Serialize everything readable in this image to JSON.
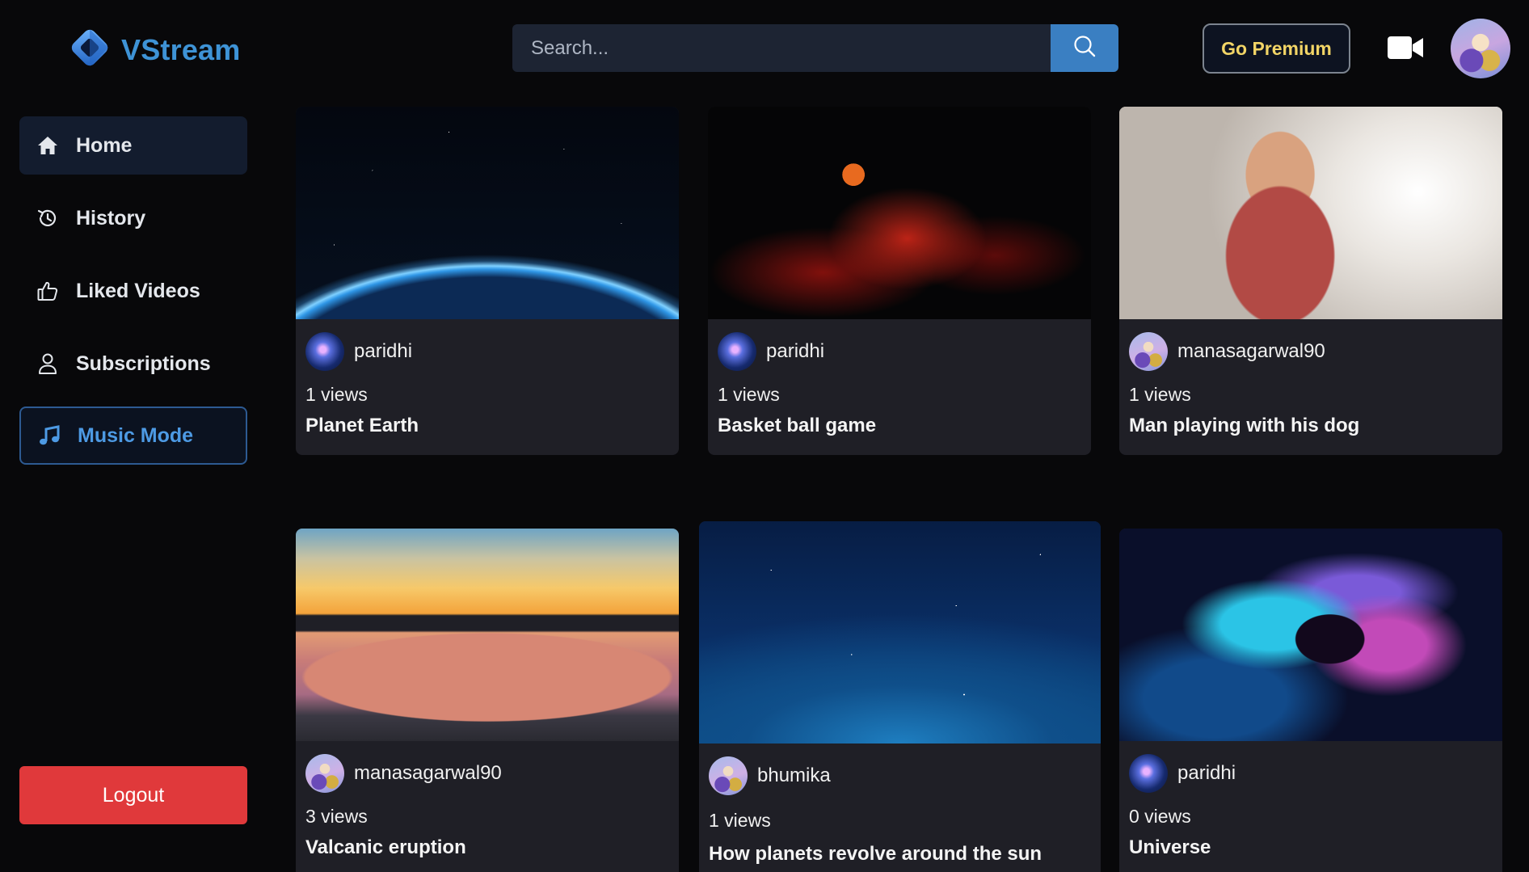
{
  "app": {
    "name": "VStream",
    "brand_color": "#3e93d6",
    "logo_icon": "diamond-logo-icon"
  },
  "header": {
    "search_placeholder": "Search...",
    "search_icon": "search-icon",
    "premium_label": "Go Premium",
    "upload_icon": "video-camera-icon",
    "avatar_icon": "user-avatar"
  },
  "sidebar": {
    "items": [
      {
        "label": "Home",
        "icon": "home-icon",
        "active": true
      },
      {
        "label": "History",
        "icon": "history-icon"
      },
      {
        "label": "Liked Videos",
        "icon": "thumbs-up-icon"
      },
      {
        "label": "Subscriptions",
        "icon": "user-icon"
      },
      {
        "label": "Music Mode",
        "icon": "music-note-icon"
      }
    ],
    "logout_label": "Logout"
  },
  "videos": [
    {
      "channel": "paridhi",
      "views": "1 views",
      "title": "Planet Earth"
    },
    {
      "channel": "paridhi",
      "views": "1 views",
      "title": "Basket ball game"
    },
    {
      "channel": "manasagarwal90",
      "views": "1 views",
      "title": "Man playing with his dog"
    },
    {
      "channel": "manasagarwal90",
      "views": "3 views",
      "title": "Valcanic eruption"
    },
    {
      "channel": "bhumika",
      "views": "1 views",
      "title": "How planets revolve around the sun"
    },
    {
      "channel": "paridhi",
      "views": "0 views",
      "title": "Universe"
    }
  ],
  "colors": {
    "background": "#08080a",
    "card": "#1f1f26",
    "logout": "#e0393b",
    "premium_text": "#f2d566",
    "music_accent": "#4d9ae4"
  }
}
